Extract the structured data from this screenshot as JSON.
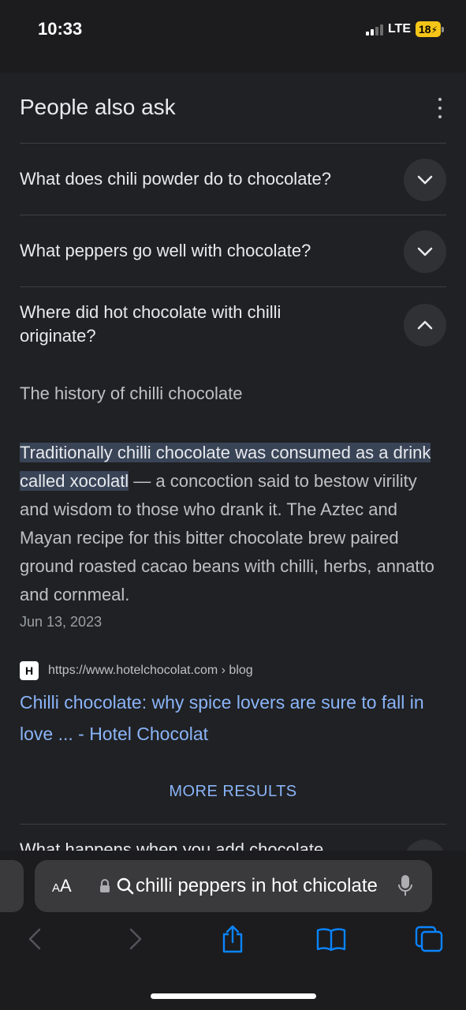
{
  "status_bar": {
    "time": "10:33",
    "network": "LTE",
    "battery": "18"
  },
  "paa": {
    "title": "People also ask",
    "questions": [
      {
        "text": "What does chili powder do to chocolate?",
        "expanded": false
      },
      {
        "text": "What peppers go well with chocolate?",
        "expanded": false
      },
      {
        "text": "Where did hot chocolate with chilli originate?",
        "expanded": true
      }
    ],
    "answer": {
      "heading": "The history of chilli chocolate",
      "highlight": "Traditionally chilli chocolate was consumed as a drink called xocolatl",
      "body": " — a concoction said to bestow virility and wisdom to those who drank it. The Aztec and Mayan recipe for this bitter chocolate brew paired ground roasted cacao beans with chilli, herbs, annatto and cornmeal.",
      "date": "Jun 13, 2023",
      "source_url": "https://www.hotelchocolat.com › blog",
      "source_title": "Chilli chocolate: why spice lovers are sure to fall in love ... - Hotel Chocolat",
      "favicon_letter": "H"
    },
    "more_results": "MORE RESULTS",
    "next_question_partial": "What happens when you add chocolate"
  },
  "browser": {
    "aa_label_small": "A",
    "aa_label_large": "A",
    "query": "chilli peppers in hot chicolate",
    "icons": [
      "lock-icon",
      "search-icon",
      "microphone-icon",
      "back-icon",
      "forward-icon",
      "share-icon",
      "bookmarks-icon",
      "tabs-icon"
    ]
  },
  "colors": {
    "background": "#202124",
    "link": "#8ab4f8",
    "highlight": "#394457",
    "battery": "#f5c518"
  }
}
